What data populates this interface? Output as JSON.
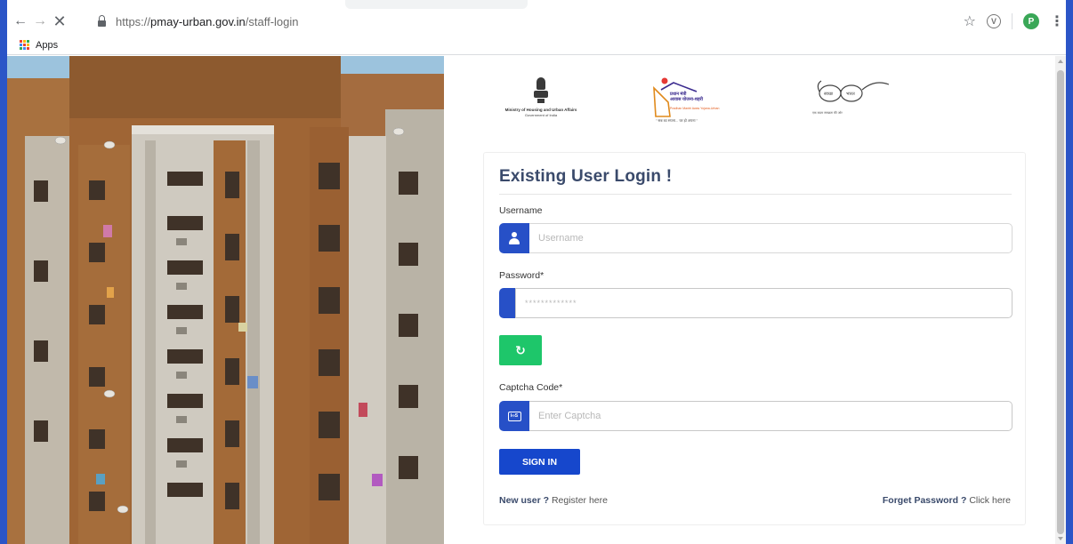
{
  "browser": {
    "back_icon": "arrow-left-icon",
    "forward_icon": "arrow-right-icon",
    "close_icon": "close-icon",
    "url_scheme": "https://",
    "url_host": "pmay-urban.gov.in",
    "url_path": "/staff-login",
    "profile_initial": "P",
    "extension_label": "V",
    "bookmarks": {
      "apps_label": "Apps"
    }
  },
  "logos": {
    "ministry_name": "Ministry of Housing and Urban Affairs",
    "ministry_sub": "Government of India",
    "pmay_line1": "प्रधान मंत्री",
    "pmay_line2": "आवास योजना-शहरी",
    "pmay_en": "Pradhan Mantri Awas Yojana-Urban",
    "pmay_tagline": "\" सब का सपना... घर हो अपना \"",
    "swachh_left": "स्वच्छ",
    "swachh_right": "भारत",
    "swachh_tagline": "एक कदम स्वच्छता की ओर"
  },
  "login": {
    "title": "Existing User Login !",
    "username_label": "Username",
    "username_placeholder": "Username",
    "password_label": "Password*",
    "password_placeholder": "*************",
    "refresh_icon": "↻",
    "captcha_label": "Captcha Code*",
    "captcha_placeholder": "Enter Captcha",
    "captcha_icon_text": "I∞S",
    "signin_label": "SIGN IN",
    "new_user_bold": "New user ?",
    "new_user_link": "Register here",
    "forgot_bold": "Forget Password ?",
    "forgot_link": "Click here"
  },
  "colors": {
    "primary": "#1647cc",
    "addon": "#2750c7",
    "refresh": "#1ec66a",
    "title": "#3a4a6b"
  }
}
